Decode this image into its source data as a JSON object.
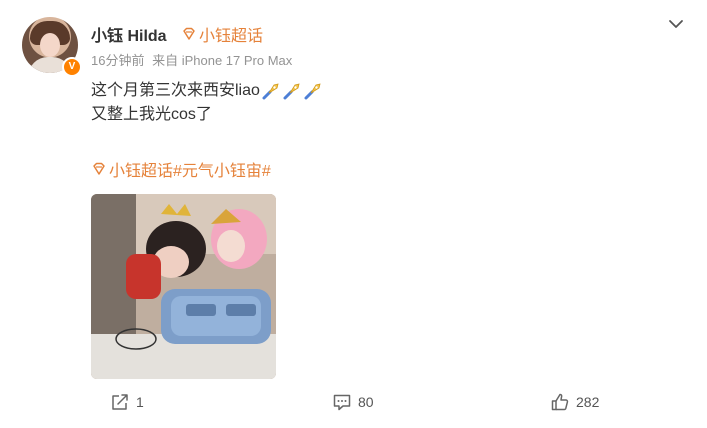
{
  "user": {
    "name": "小钰 Hilda",
    "verified_badge": "V",
    "supertopic_label": "小钰超话"
  },
  "meta": {
    "time": "16分钟前",
    "source": "来自 iPhone 17 Pro Max"
  },
  "content": {
    "line1": "这个月第三次来西安liao",
    "line2": "又整上我光cos了",
    "emoji_name": "rocket-emoji",
    "emoji_count": 3
  },
  "topics": {
    "supertopic": "小钰超话",
    "hashtag": "#元气小钰宙#"
  },
  "actions": {
    "repost_count": "1",
    "comment_count": "80",
    "like_count": "282"
  },
  "colors": {
    "accent": "#e5823a",
    "meta_gray": "#939393",
    "verified_orange": "#ff8200"
  }
}
